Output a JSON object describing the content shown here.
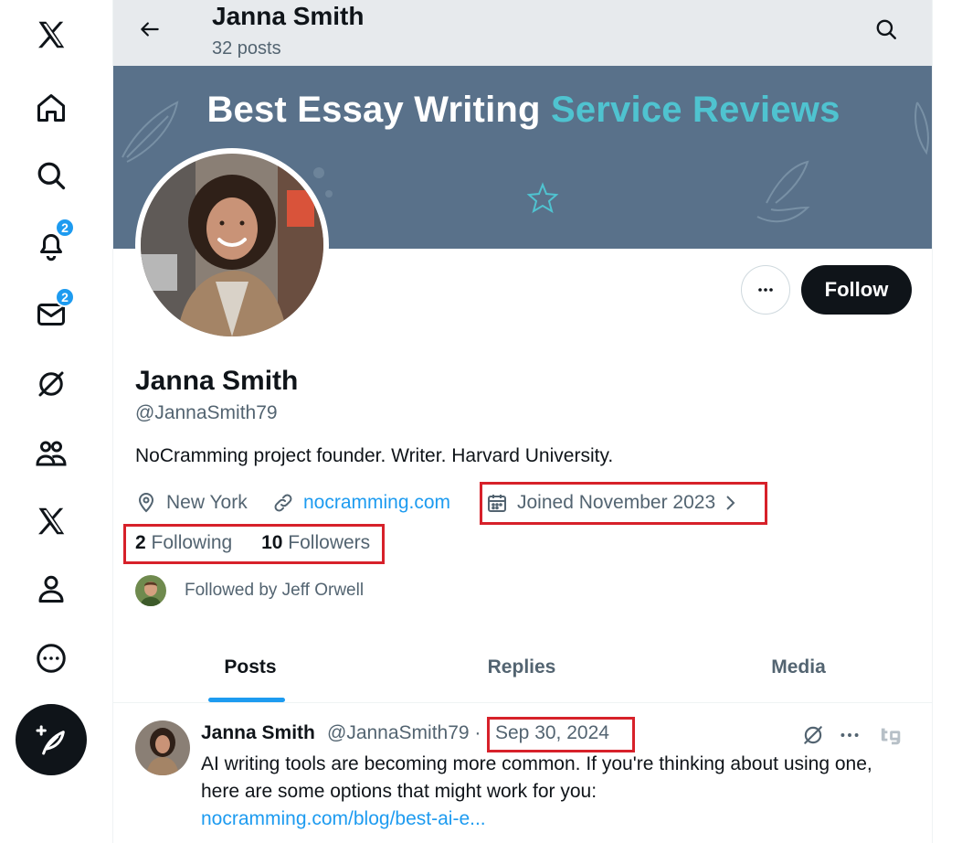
{
  "nav": {
    "notifications_badge": "2",
    "messages_badge": "2"
  },
  "header": {
    "name": "Janna Smith",
    "posts_count": "32 posts"
  },
  "banner": {
    "title_main": "Best Essay Writing ",
    "title_accent": "Service Reviews",
    "background_color": "#59718a",
    "accent_color": "#4fc3d0"
  },
  "profile": {
    "follow_label": "Follow",
    "name": "Janna Smith",
    "handle": "@JannaSmith79",
    "bio": "NoCramming project founder. Writer. Harvard University.",
    "location": "New York",
    "website": "nocramming.com",
    "joined": "Joined November 2023",
    "following_count": "2",
    "following_label": "Following",
    "followers_count": "10",
    "followers_label": "Followers",
    "followed_by": "Followed by Jeff Orwell"
  },
  "tabs": [
    {
      "label": "Posts"
    },
    {
      "label": "Replies"
    },
    {
      "label": "Media"
    }
  ],
  "post": {
    "name": "Janna Smith",
    "handle": "@JannaSmith79",
    "separator": "·",
    "date": "Sep 30, 2024",
    "text": "AI writing tools are becoming more common. If you're thinking about using one, here are some options that might work for you:",
    "link": "nocramming.com/blog/best-ai-e..."
  },
  "colors": {
    "accent": "#1d9bf0",
    "highlight_box": "#d7212a",
    "text_primary": "#0f1419",
    "text_secondary": "#536471"
  }
}
